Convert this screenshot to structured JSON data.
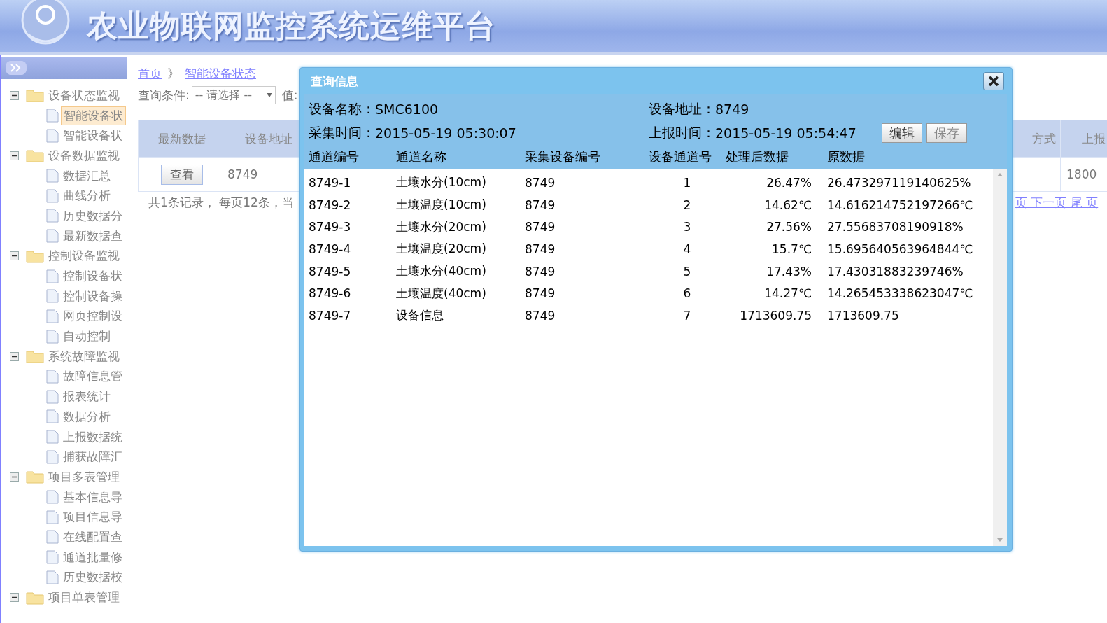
{
  "header": {
    "title": "农业物联网监控系统运维平台"
  },
  "sidebar": {
    "items": [
      {
        "label": "设备状态监视",
        "expanded": true,
        "children": [
          {
            "label": "智能设备状",
            "selected": true
          },
          {
            "label": "智能设备状",
            "selected": false
          }
        ]
      },
      {
        "label": "设备数据监视",
        "expanded": true,
        "children": [
          {
            "label": "数据汇总",
            "selected": false
          },
          {
            "label": "曲线分析",
            "selected": false
          },
          {
            "label": "历史数据分",
            "selected": false
          },
          {
            "label": "最新数据查",
            "selected": false
          }
        ]
      },
      {
        "label": "控制设备监视",
        "expanded": true,
        "children": [
          {
            "label": "控制设备状",
            "selected": false
          },
          {
            "label": "控制设备操",
            "selected": false
          },
          {
            "label": "网页控制设",
            "selected": false
          },
          {
            "label": "自动控制",
            "selected": false
          }
        ]
      },
      {
        "label": "系统故障监视",
        "expanded": true,
        "children": [
          {
            "label": "故障信息管",
            "selected": false
          },
          {
            "label": "报表统计",
            "selected": false
          },
          {
            "label": "数据分析",
            "selected": false
          },
          {
            "label": "上报数据统",
            "selected": false
          },
          {
            "label": "捕获故障汇",
            "selected": false
          }
        ]
      },
      {
        "label": "项目多表管理",
        "expanded": true,
        "children": [
          {
            "label": "基本信息导",
            "selected": false
          },
          {
            "label": "项目信息导",
            "selected": false
          },
          {
            "label": "在线配置查",
            "selected": false
          },
          {
            "label": "通道批量修",
            "selected": false
          },
          {
            "label": "历史数据校",
            "selected": false
          }
        ]
      },
      {
        "label": "项目单表管理",
        "expanded": true
      }
    ]
  },
  "breadcrumb": [
    "首页",
    "智能设备状态"
  ],
  "breadcrumb_separator": "》",
  "query": {
    "label": "查询条件:",
    "select": "-- 请选择 --",
    "value_label": "值:"
  },
  "table": {
    "columns": [
      "最新数据",
      "设备地址",
      "方式",
      "上报"
    ],
    "rows": [
      {
        "button": "查看",
        "address": "8749",
        "column_4": "1800"
      }
    ]
  },
  "summary": "共1条记录， 每页12条，当",
  "pager": "页 下一页 尾 页",
  "dialog": {
    "title": "查询信息",
    "fields": [
      {
        "label": "设备名称：",
        "value": "SMC6100"
      },
      {
        "label": "设备地址：",
        "value": "8749"
      },
      {
        "label": "采集时间：",
        "value": "2015-05-19 05:30:07"
      },
      {
        "label": "上报时间：",
        "value": "2015-05-19 05:54:47"
      }
    ],
    "buttons": [
      "编辑",
      "保存"
    ],
    "columns": [
      "通道编号",
      "通道名称",
      "采集设备编号",
      "设备通道号",
      "处理后数据",
      "原数据"
    ],
    "rows": [
      [
        "8749-1",
        "土壤水分(10cm)",
        "8749",
        "1",
        "26.47%",
        "26.473297119140625%"
      ],
      [
        "8749-2",
        "土壤温度(10cm)",
        "8749",
        "2",
        "14.62℃",
        "14.616214752197266℃"
      ],
      [
        "8749-3",
        "土壤水分(20cm)",
        "8749",
        "3",
        "27.56%",
        "27.55683708190918%"
      ],
      [
        "8749-4",
        "土壤温度(20cm)",
        "8749",
        "4",
        "15.7℃",
        "15.695640563964844℃"
      ],
      [
        "8749-5",
        "土壤水分(40cm)",
        "8749",
        "5",
        "17.43%",
        "17.43031883239746%"
      ],
      [
        "8749-6",
        "土壤温度(40cm)",
        "8749",
        "6",
        "14.27℃",
        "14.265453338623047℃"
      ],
      [
        "8749-7",
        "设备信息",
        "8749",
        "7",
        "1713609.75",
        "1713609.75"
      ]
    ]
  }
}
